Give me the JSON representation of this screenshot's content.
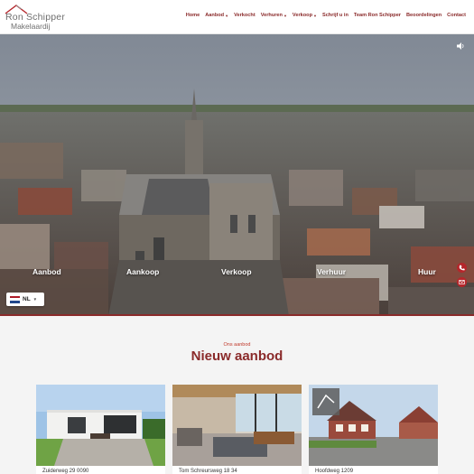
{
  "brand": {
    "name": "Ron Schipper",
    "subtitle": "Makelaardij",
    "color": "#8a2a2a"
  },
  "nav": {
    "items": [
      {
        "label": "Home",
        "has_dropdown": false
      },
      {
        "label": "Aanbod",
        "has_dropdown": true
      },
      {
        "label": "Verkocht",
        "has_dropdown": false
      },
      {
        "label": "Verhuren",
        "has_dropdown": true
      },
      {
        "label": "Verkoop",
        "has_dropdown": true
      },
      {
        "label": "Schrijf u in",
        "has_dropdown": false
      },
      {
        "label": "Team Ron Schipper",
        "has_dropdown": false
      },
      {
        "label": "Beoordelingen",
        "has_dropdown": false
      },
      {
        "label": "Contact",
        "has_dropdown": false
      }
    ]
  },
  "hero": {
    "links": [
      "Aanbod",
      "Aankoop",
      "Verkoop",
      "Verhuur",
      "Huur"
    ],
    "language": {
      "label": "NL",
      "flag": "netherlands-flag"
    },
    "icons": [
      "sound-icon",
      "phone-icon",
      "mail-icon"
    ]
  },
  "section": {
    "eyebrow": "Ons aanbod",
    "title": "Nieuw aanbod"
  },
  "listings": [
    {
      "address": "Zuiderweg 29 0090"
    },
    {
      "address": "Tom Schreursweg 18 34"
    },
    {
      "address": "Hoofdweg 1209"
    }
  ]
}
